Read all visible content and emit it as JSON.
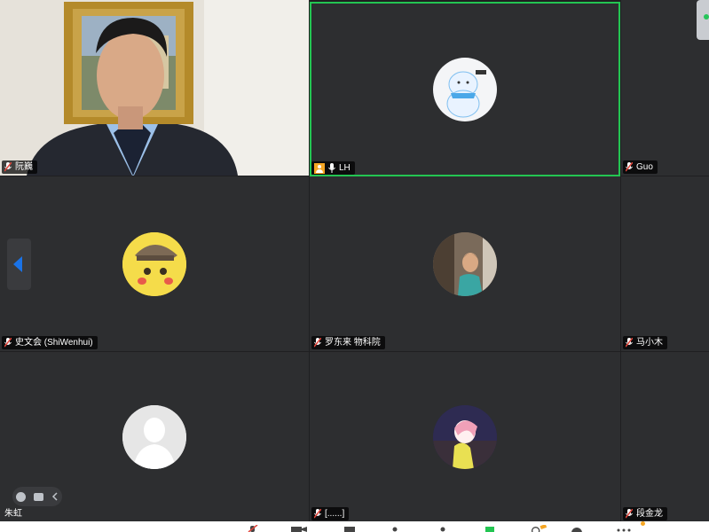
{
  "participants": [
    {
      "name": "阮巍",
      "muted": true
    },
    {
      "name": "LH",
      "muted": false
    },
    {
      "name": "Guo",
      "muted": true
    },
    {
      "name": "史文会 (ShiWenhui)",
      "muted": true
    },
    {
      "name": "罗东来 物科院",
      "muted": true
    },
    {
      "name": "马小木",
      "muted": true
    },
    {
      "name": "朱虹",
      "muted": true
    },
    {
      "name": "[......]",
      "muted": true
    },
    {
      "name": "段金龙",
      "muted": true
    }
  ],
  "colors": {
    "active_speaker_border": "#23c552",
    "tile_background": "#2d2e30",
    "muted_mic": "#e0453b"
  },
  "icons": {
    "page_prev": "left-arrow-icon",
    "reactions": "emoji-icon",
    "chat": "chat-icon",
    "collapse": "chevron-left-icon"
  }
}
